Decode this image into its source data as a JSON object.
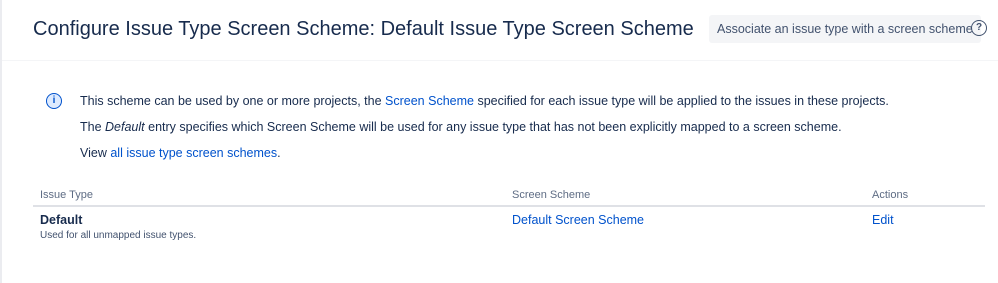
{
  "header": {
    "title": "Configure Issue Type Screen Scheme: Default Issue Type Screen Scheme",
    "associate_button": "Associate an issue type with a screen scheme",
    "help_icon": "question-circle-icon"
  },
  "info": {
    "icon": "info-icon",
    "line1_pre": "This scheme can be used by one or more projects, the",
    "line1_link": "Screen Scheme",
    "line1_post": "specified for each issue type will be applied to the issues in these projects.",
    "line2_pre": "The",
    "line2_em": "Default",
    "line2_post": "entry specifies which Screen Scheme will be used for any issue type that has not been explicitly mapped to a screen scheme.",
    "line3_pre": "View",
    "line3_link": "all issue type screen schemes",
    "line3_post": "."
  },
  "table": {
    "columns": [
      "Issue Type",
      "Screen Scheme",
      "Actions"
    ],
    "rows": [
      {
        "issue_type": "Default",
        "description": "Used for all unmapped issue types.",
        "screen_scheme": "Default Screen Scheme",
        "action": "Edit"
      }
    ]
  },
  "colors": {
    "link": "#0052cc",
    "text": "#172b4d",
    "subtle": "#5e6c84",
    "button_bg": "#f4f5f7"
  }
}
